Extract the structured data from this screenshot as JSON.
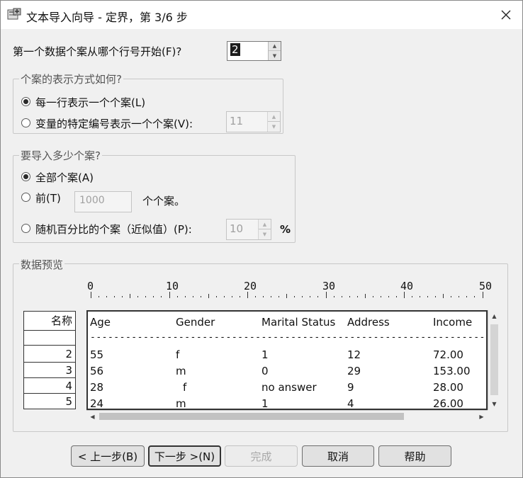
{
  "window": {
    "title": "文本导入向导 - 定界，第 3/6 步",
    "close_glyph": "✕"
  },
  "first_case": {
    "label": "第一个数据个案从哪个行号开始(F)?",
    "value": "2"
  },
  "case_repr": {
    "title": "个案的表示方式如何?",
    "opt_each_line": "每一行表示一个个案(L)",
    "opt_specific_vars": "变量的特定编号表示一个个案(V):",
    "spec_value": "11",
    "selected": "each_line"
  },
  "import_count": {
    "title": "要导入多少个案?",
    "opt_all": "全部个案(A)",
    "opt_first": "前(T)",
    "first_value": "1000",
    "first_suffix": "个个案。",
    "opt_random": "随机百分比的个案（近似值）(P):",
    "random_value": "10",
    "percent": "%",
    "selected": "all"
  },
  "preview": {
    "title": "数据预览",
    "ruler_labels": [
      "0",
      "10",
      "20",
      "30",
      "40",
      "50"
    ],
    "name_header": "名称",
    "row_numbers": [
      "",
      "2",
      "3",
      "4",
      "5"
    ],
    "columns": [
      "Age",
      "Gender",
      "Marital Status",
      "Address",
      "Income"
    ],
    "separator": "-----------------------------------------------------------------------",
    "rows": [
      [
        "55",
        "f",
        "1",
        "12",
        "72.00"
      ],
      [
        "56",
        "m",
        "0",
        "29",
        "153.00"
      ],
      [
        "28",
        "f",
        "no answer",
        "9",
        "28.00"
      ],
      [
        "24",
        "m",
        "1",
        "4",
        "26.00"
      ]
    ]
  },
  "buttons": {
    "back": "< 上一步(B)",
    "next": "下一步 >(N)",
    "finish": "完成",
    "cancel": "取消",
    "help": "帮助"
  }
}
